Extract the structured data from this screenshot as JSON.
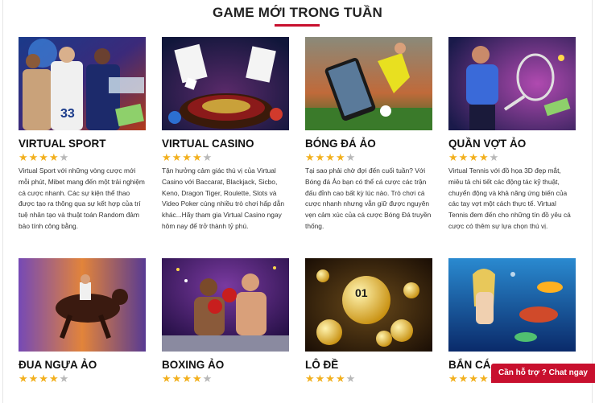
{
  "section": {
    "title": "GAME MỚI TRONG TUẦN"
  },
  "games": [
    {
      "title": "VIRTUAL SPORT",
      "rating": 4,
      "max_rating": 5,
      "image_icon": "football-players-image",
      "description": "Virtual Sport với những vòng cược mới mỗi phút, Mibet mang đến một trải nghiệm cá cược nhanh. Các sự kiện thể thao được tạo ra thông qua sự kết hợp của trí tuệ nhân tạo và thuật toán Random đảm bảo tính công bằng."
    },
    {
      "title": "VIRTUAL CASINO",
      "rating": 4,
      "max_rating": 5,
      "image_icon": "casino-roulette-image",
      "description": "Tận hưởng cảm giác thú vị của Virtual Casino với Baccarat, Blackjack, Sicbo, Keno, Dragon Tiger, Roulette, Slots và Video Poker cùng nhiều trò chơi hấp dẫn khác...Hãy tham gia Virtual Casino ngay hôm nay để trở thành tỷ phú."
    },
    {
      "title": "BÓNG ĐÁ ẢO",
      "rating": 4,
      "max_rating": 5,
      "image_icon": "virtual-football-image",
      "description": "Tại sao phải chờ đợi đến cuối tuần? Với Bóng đá Ảo bạn có thể cá cược các trận đấu đỉnh cao bất kỳ lúc nào. Trò chơi cá cược nhanh nhưng vẫn giữ được nguyên vẹn cảm xúc của cá cược Bóng Đá truyền thống."
    },
    {
      "title": "QUẦN VỢT ẢO",
      "rating": 4,
      "max_rating": 5,
      "image_icon": "tennis-player-image",
      "description": "Virtual Tennis với đồ họa 3D đẹp mắt, miêu tả chi tiết các động tác kỹ thuật, chuyển động và khả năng ứng biến của các tay vợt một cách thực tế. Virtual Tennis đem đến cho những tín đồ yêu cá cược có thêm sự lựa chọn thú vị."
    },
    {
      "title": "ĐUA NGỰA ẢO",
      "rating": 4,
      "max_rating": 5,
      "image_icon": "horse-racing-image",
      "description": ""
    },
    {
      "title": "BOXING ẢO",
      "rating": 4,
      "max_rating": 5,
      "image_icon": "boxing-image",
      "description": ""
    },
    {
      "title": "LÔ ĐỀ",
      "rating": 4,
      "max_rating": 5,
      "image_icon": "lottery-balls-image",
      "description": ""
    },
    {
      "title": "BẮN CÁ",
      "rating": 4,
      "max_rating": 5,
      "image_icon": "fish-shooting-image",
      "description": ""
    }
  ],
  "chat": {
    "label": "Cần hỗ trợ ? Chat ngay"
  },
  "colors": {
    "accent": "#c8102e",
    "star": "#f2b01e",
    "star_empty": "#b8b8b8"
  }
}
